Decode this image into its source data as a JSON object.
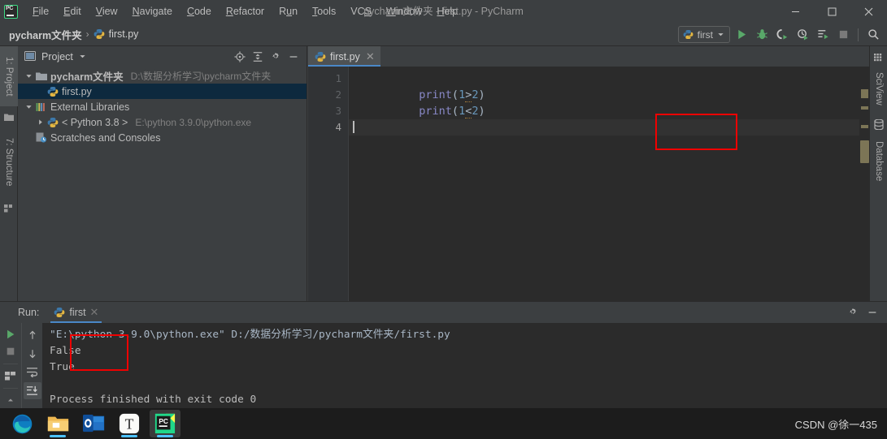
{
  "window": {
    "title": "pycharm文件夹 - first.py - PyCharm",
    "app_logo": "pycharm-logo-icon",
    "minimize_label": "minimize-icon",
    "maximize_label": "maximize-icon",
    "close_label": "close-icon"
  },
  "menubar": {
    "items": [
      {
        "label": "File",
        "mnemonic": "F"
      },
      {
        "label": "Edit",
        "mnemonic": "E"
      },
      {
        "label": "View",
        "mnemonic": "V"
      },
      {
        "label": "Navigate",
        "mnemonic": "N"
      },
      {
        "label": "Code",
        "mnemonic": "C"
      },
      {
        "label": "Refactor",
        "mnemonic": "R"
      },
      {
        "label": "Run",
        "mnemonic": "u"
      },
      {
        "label": "Tools",
        "mnemonic": "T"
      },
      {
        "label": "VCS",
        "mnemonic": "S"
      },
      {
        "label": "Window",
        "mnemonic": "W"
      },
      {
        "label": "Help",
        "mnemonic": "H"
      }
    ]
  },
  "breadcrumb": {
    "project": "pycharm文件夹",
    "separator": "›",
    "file": "first.py",
    "file_icon": "python-file-icon"
  },
  "toolbar": {
    "run_config_name": "first",
    "run_config_icon": "python-icon",
    "dropdown_icon": "chevron-down-icon",
    "buttons": [
      {
        "name": "run-button",
        "icon": "play-icon"
      },
      {
        "name": "debug-button",
        "icon": "bug-icon"
      },
      {
        "name": "run-with-coverage-button",
        "icon": "coverage-icon"
      },
      {
        "name": "profile-button",
        "icon": "profile-icon"
      },
      {
        "name": "run-tests-button",
        "icon": "run-tests-icon"
      },
      {
        "name": "stop-button",
        "icon": "stop-square-icon"
      },
      {
        "name": "search-everywhere-button",
        "icon": "search-icon"
      }
    ]
  },
  "left_strip": {
    "tabs": [
      {
        "label": "1: Project",
        "icon": "folder-icon",
        "selected": true
      },
      {
        "label": "7: Structure",
        "icon": "structure-icon",
        "selected": false
      }
    ]
  },
  "right_strip": {
    "tabs": [
      {
        "label": "SciView",
        "icon": "grid-icon"
      },
      {
        "label": "Database",
        "icon": "database-icon"
      }
    ]
  },
  "project_panel": {
    "title": "Project",
    "title_icon": "project-icon",
    "dropdown_icon": "chevron-down-icon",
    "header_icons": [
      {
        "name": "scroll-from-source-icon",
        "label": "target-icon"
      },
      {
        "name": "collapse-all-icon",
        "label": "collapse-icon"
      },
      {
        "name": "settings-gear-icon",
        "label": "gear-icon"
      },
      {
        "name": "hide-panel-icon",
        "label": "minimize-icon"
      }
    ],
    "tree": [
      {
        "label": "pycharm文件夹",
        "path": "D:\\数据分析学习\\pycharm文件夹",
        "icon": "folder-icon",
        "arrow": "expanded",
        "depth": 0,
        "bold": true,
        "selected": false
      },
      {
        "label": "first.py",
        "path": "",
        "icon": "python-file-icon",
        "arrow": "none",
        "depth": 1,
        "bold": false,
        "selected": true
      },
      {
        "label": "External Libraries",
        "path": "",
        "icon": "libraries-icon",
        "arrow": "expanded",
        "depth": 0,
        "bold": false,
        "selected": false
      },
      {
        "label": "< Python 3.8 >",
        "path": "E:\\python 3.9.0\\python.exe",
        "icon": "python-icon",
        "arrow": "collapsed",
        "depth": 1,
        "bold": false,
        "selected": false
      },
      {
        "label": "Scratches and Consoles",
        "path": "",
        "icon": "scratches-icon",
        "arrow": "none",
        "depth": 0,
        "bold": false,
        "selected": false
      }
    ]
  },
  "editor": {
    "tab": {
      "label": "first.py",
      "icon": "python-file-icon",
      "close_icon": "close-icon"
    },
    "line_numbers": [
      "1",
      "2",
      "3",
      "4"
    ],
    "current_line": 4,
    "lines": [
      {
        "num": "1",
        "tokens": [
          {
            "t": "print",
            "c": "fn"
          },
          {
            "t": "(",
            "c": "punct"
          },
          {
            "t": "1",
            "c": "num"
          },
          {
            "t": ">",
            "c": "op"
          },
          {
            "t": "2",
            "c": "num"
          },
          {
            "t": ")",
            "c": "punct"
          }
        ]
      },
      {
        "num": "2",
        "tokens": [
          {
            "t": "print",
            "c": "fn"
          },
          {
            "t": "(",
            "c": "punct"
          },
          {
            "t": "1",
            "c": "num"
          },
          {
            "t": "<",
            "c": "op"
          },
          {
            "t": "2",
            "c": "num"
          },
          {
            "t": ")",
            "c": "punct"
          }
        ]
      },
      {
        "num": "3",
        "tokens": []
      },
      {
        "num": "4",
        "tokens": []
      }
    ],
    "plain_text": "print(1>2)\nprint(1<2)\n\n",
    "highlight_box": {
      "name": "code-red-annotation-box",
      "color": "#f00000"
    }
  },
  "run_panel": {
    "label": "Run:",
    "tab_label": "first",
    "tab_icon": "python-icon",
    "tab_close_icon": "close-icon",
    "header_icons": [
      {
        "name": "settings-gear-icon"
      },
      {
        "name": "hide-panel-icon"
      }
    ],
    "side_icons": [
      {
        "name": "rerun-button",
        "icon": "play-icon",
        "active": false
      },
      {
        "name": "stop-button",
        "icon": "stop-square-icon",
        "active": false
      },
      {
        "name": "print-button",
        "icon": "layout-icon",
        "active": false
      },
      {
        "name": "up-arrow-button",
        "icon": "arrow-up-icon",
        "active": false
      },
      {
        "name": "down-arrow-button",
        "icon": "arrow-down-icon",
        "active": false
      },
      {
        "name": "soft-wrap-button",
        "icon": "wrap-text-icon",
        "active": false
      },
      {
        "name": "scroll-to-end-button",
        "icon": "scroll-end-icon",
        "active": true
      }
    ],
    "console": {
      "command": "\"E:\\python 3.9.0\\python.exe\" D:/数据分析学习/pycharm文件夹/first.py",
      "output_lines": [
        "False",
        "True"
      ],
      "blank_line": "",
      "exit_line": "Process finished with exit code 0",
      "highlight_box": {
        "name": "output-red-annotation-box",
        "color": "#f00000"
      }
    }
  },
  "taskbar": {
    "apps": [
      {
        "name": "edge-icon",
        "label": "Microsoft Edge",
        "active": false,
        "running": false
      },
      {
        "name": "file-explorer-icon",
        "label": "File Explorer",
        "active": false,
        "running": true
      },
      {
        "name": "outlook-icon",
        "label": "Outlook",
        "active": false,
        "running": false
      },
      {
        "name": "typora-icon",
        "label": "T",
        "active": false,
        "running": true
      },
      {
        "name": "pycharm-icon",
        "label": "PyCharm",
        "active": true,
        "running": true
      }
    ]
  },
  "watermark": {
    "text": "CSDN @徐一435"
  },
  "colors": {
    "accent_blue": "#4a88c7",
    "annotation_red": "#f00000",
    "run_green": "#59a869",
    "editor_bg": "#2b2b2b",
    "panel_bg": "#3c3f41",
    "selection_blue": "#0d293e",
    "keyword_purple": "#8888c6",
    "number_blue": "#6897bb",
    "scrollbar_tan": "#7c7556"
  }
}
